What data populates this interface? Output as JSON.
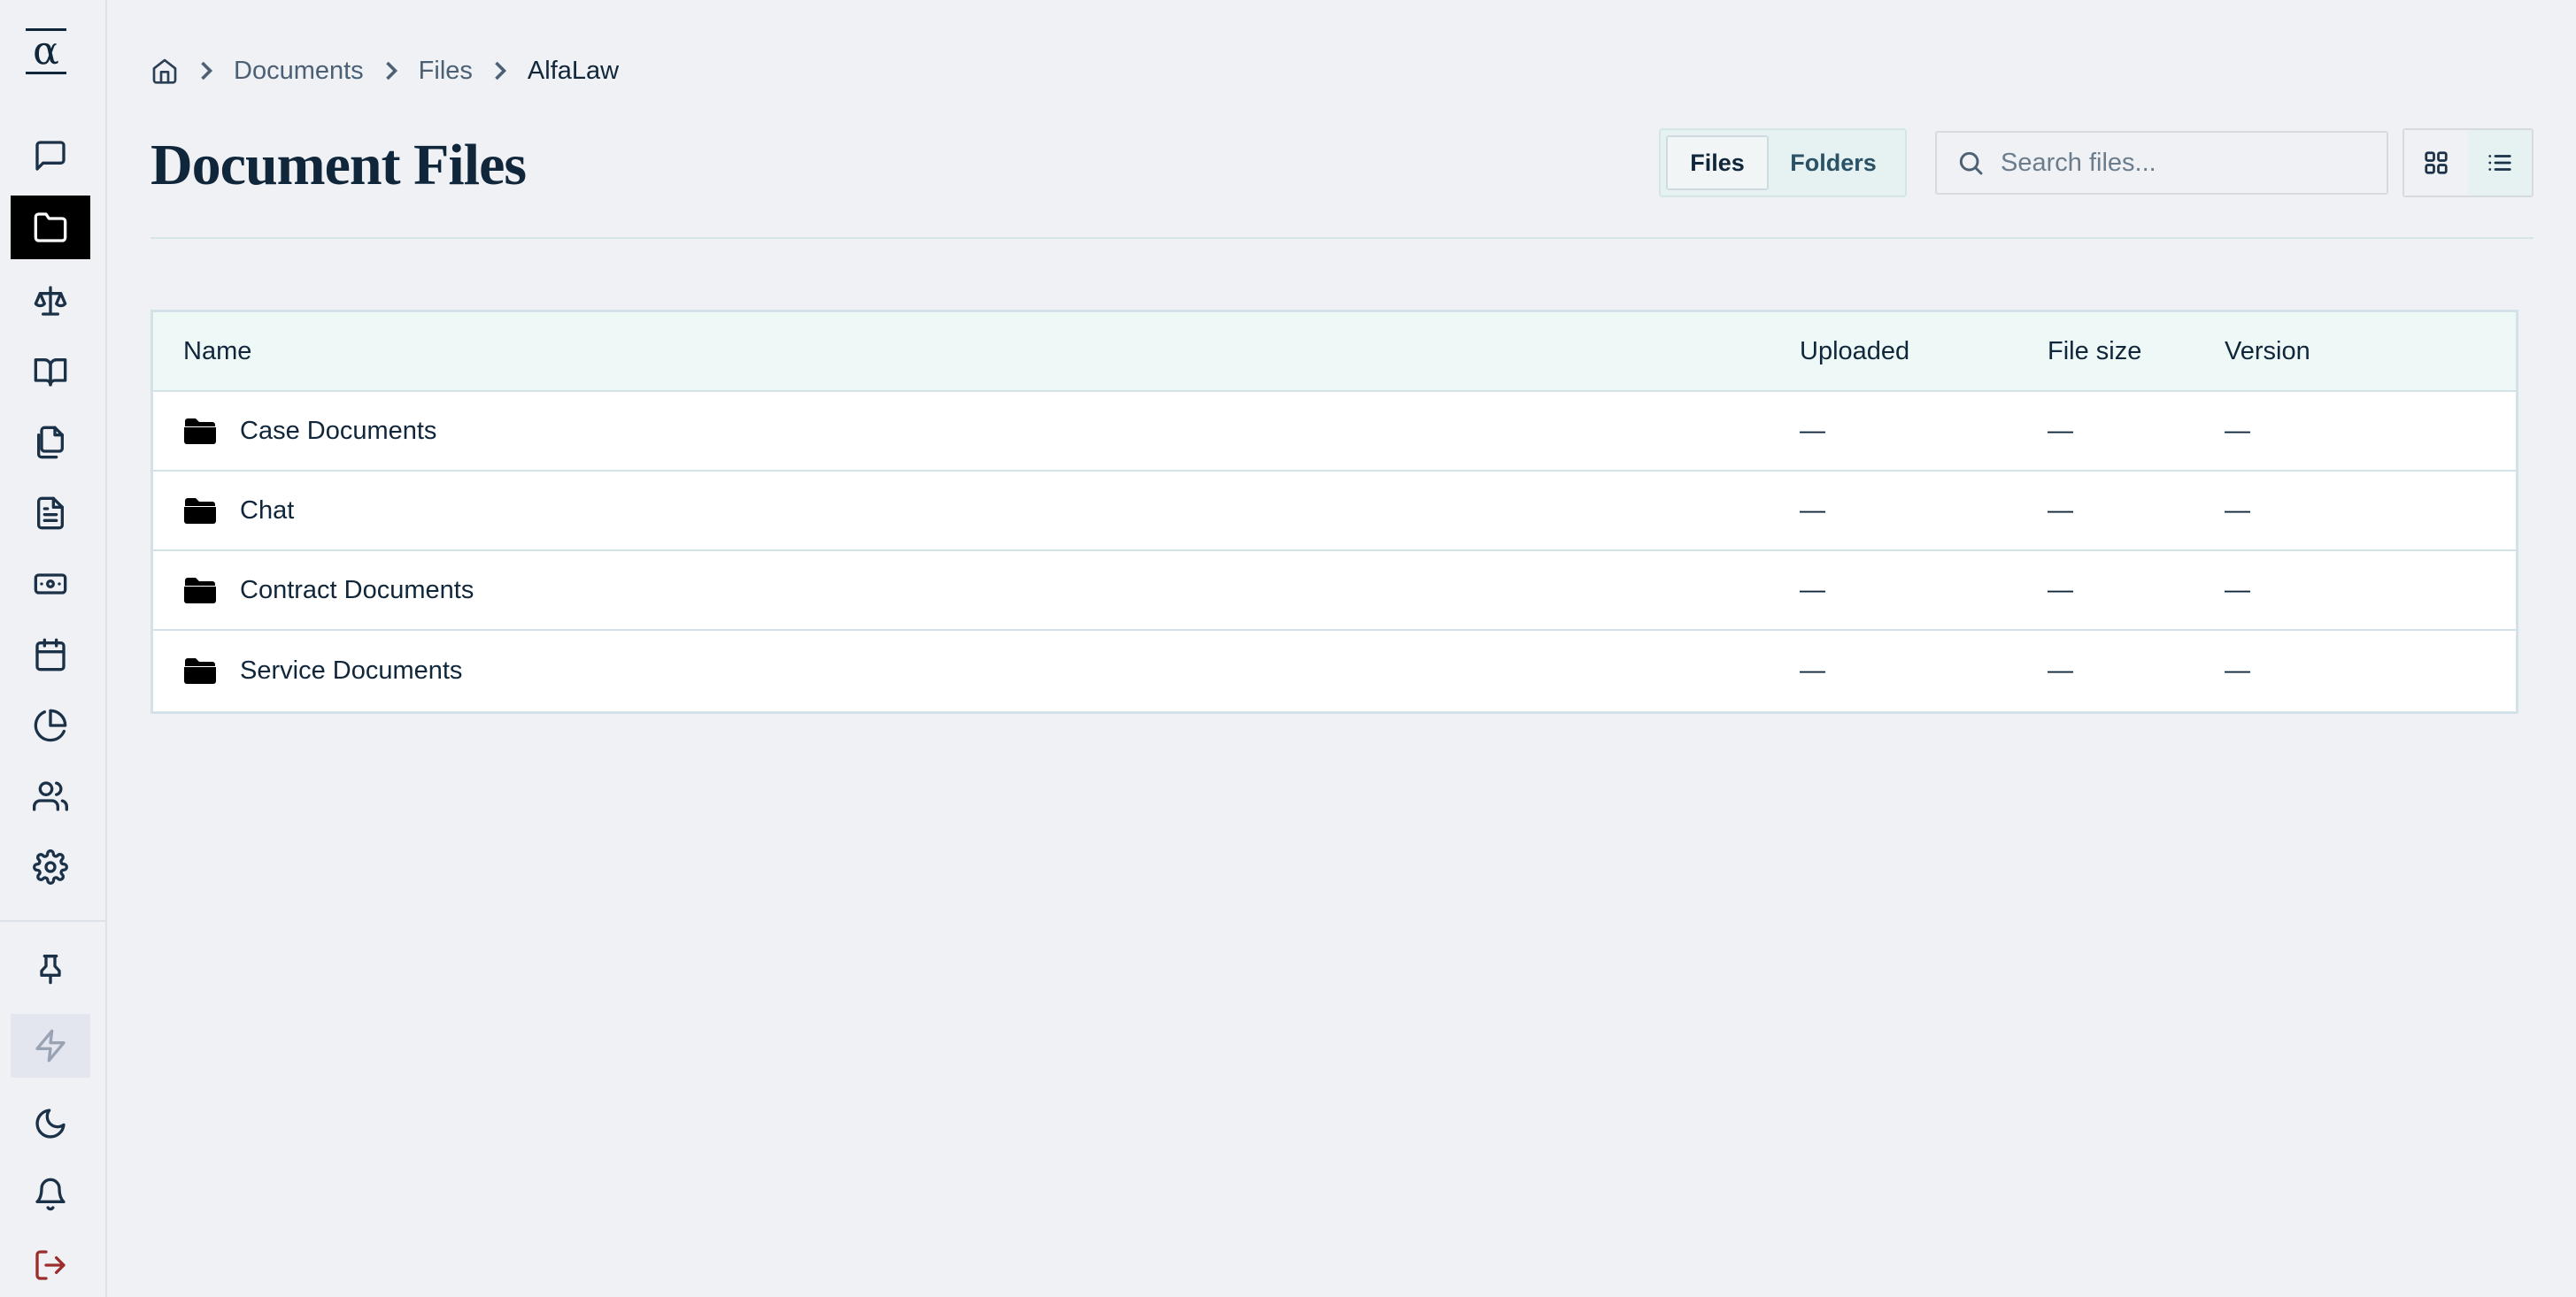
{
  "app": {
    "logo_glyph": "α"
  },
  "sidebar": {
    "items": [
      {
        "name": "chat",
        "icon": "message-square-icon"
      },
      {
        "name": "documents",
        "icon": "folder-icon",
        "active": true
      },
      {
        "name": "cases",
        "icon": "scale-icon"
      },
      {
        "name": "library",
        "icon": "book-open-icon"
      },
      {
        "name": "templates",
        "icon": "files-icon"
      },
      {
        "name": "contracts",
        "icon": "file-text-icon"
      },
      {
        "name": "billing",
        "icon": "banknote-icon"
      },
      {
        "name": "calendar",
        "icon": "calendar-icon"
      },
      {
        "name": "reports",
        "icon": "pie-chart-icon"
      },
      {
        "name": "team",
        "icon": "users-icon"
      },
      {
        "name": "settings",
        "icon": "gear-icon"
      }
    ],
    "bottom": [
      {
        "name": "pin",
        "icon": "pin-icon"
      },
      {
        "name": "quick-actions",
        "icon": "zap-icon"
      },
      {
        "name": "theme",
        "icon": "moon-icon"
      },
      {
        "name": "notifications",
        "icon": "bell-icon"
      },
      {
        "name": "logout",
        "icon": "log-out-icon"
      }
    ]
  },
  "breadcrumb": {
    "items": [
      "Documents",
      "Files"
    ],
    "current": "AlfaLaw"
  },
  "header": {
    "title": "Document Files",
    "segments": {
      "files": "Files",
      "folders": "Folders",
      "selected": "Files"
    },
    "search_placeholder": "Search files...",
    "view_mode": "list"
  },
  "table": {
    "columns": {
      "name": "Name",
      "uploaded": "Uploaded",
      "size": "File size",
      "version": "Version"
    },
    "rows": [
      {
        "name": "Case Documents",
        "uploaded": "—",
        "size": "—",
        "version": "—"
      },
      {
        "name": "Chat",
        "uploaded": "—",
        "size": "—",
        "version": "—"
      },
      {
        "name": "Contract Documents",
        "uploaded": "—",
        "size": "—",
        "version": "—"
      },
      {
        "name": "Service Documents",
        "uploaded": "—",
        "size": "—",
        "version": "—"
      }
    ]
  },
  "colors": {
    "accent_teal": "#e5f2f1",
    "active_nav": "#000000",
    "text": "#10263b",
    "logout": "#9b2d2d"
  }
}
